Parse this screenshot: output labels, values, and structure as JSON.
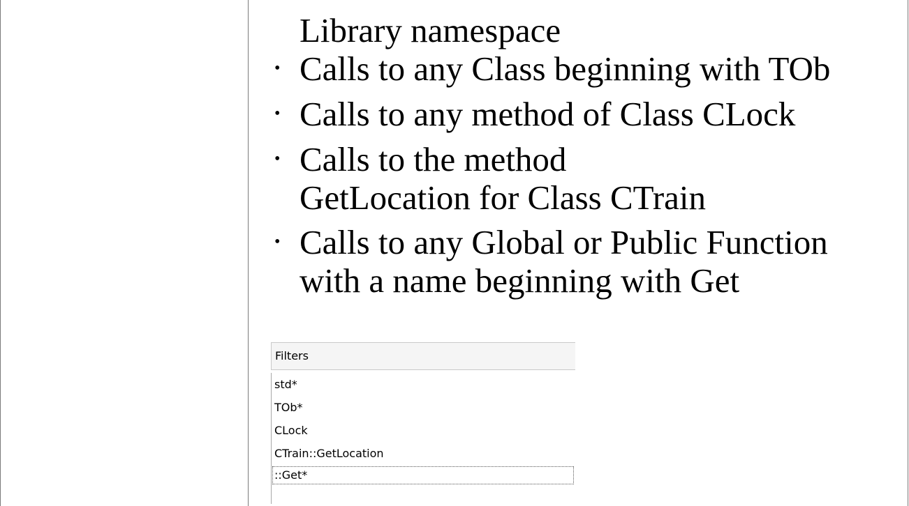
{
  "content": {
    "continuation": "Library namespace",
    "bullets": [
      "Calls to any Class beginning with TOb",
      "Calls to any method of Class CLock",
      "Calls to the method GetLocation for Class CTrain",
      "Calls to any Global or Public Function with a name beginning with Get"
    ],
    "bullet_glyph": "•"
  },
  "filters": {
    "header": "Filters",
    "items": [
      "std*",
      "TOb*",
      "CLock",
      "CTrain::GetLocation",
      "::Get*"
    ],
    "focused_index": 4
  }
}
